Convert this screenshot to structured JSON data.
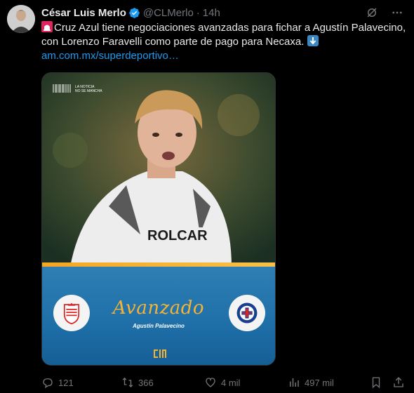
{
  "author": {
    "name": "César Luis Merlo",
    "handle": "@CLMerlo",
    "time": "14h"
  },
  "tweet": {
    "text": "Cruz Azul tiene negociaciones avanzadas para fichar a Agustín Palavecino, con Lorenzo Faravelli como parte de pago para Necaxa.",
    "link": "am.com.mx/superdeportivo…"
  },
  "media": {
    "brand_line1": "LA NOTICIA",
    "brand_line2": "NO SE MANCHA",
    "jersey_text": "ROLCAR",
    "status": "Avanzado",
    "player": "Agustín Palavecino"
  },
  "metrics": {
    "replies": "121",
    "retweets": "366",
    "likes": "4 mil",
    "views": "497 mil"
  },
  "colors": {
    "link": "#1d9bf0",
    "muted": "#71767b",
    "verified": "#1d9bf0",
    "accent_gold": "#f5b335",
    "banner_blue": "#1e6ea8"
  }
}
